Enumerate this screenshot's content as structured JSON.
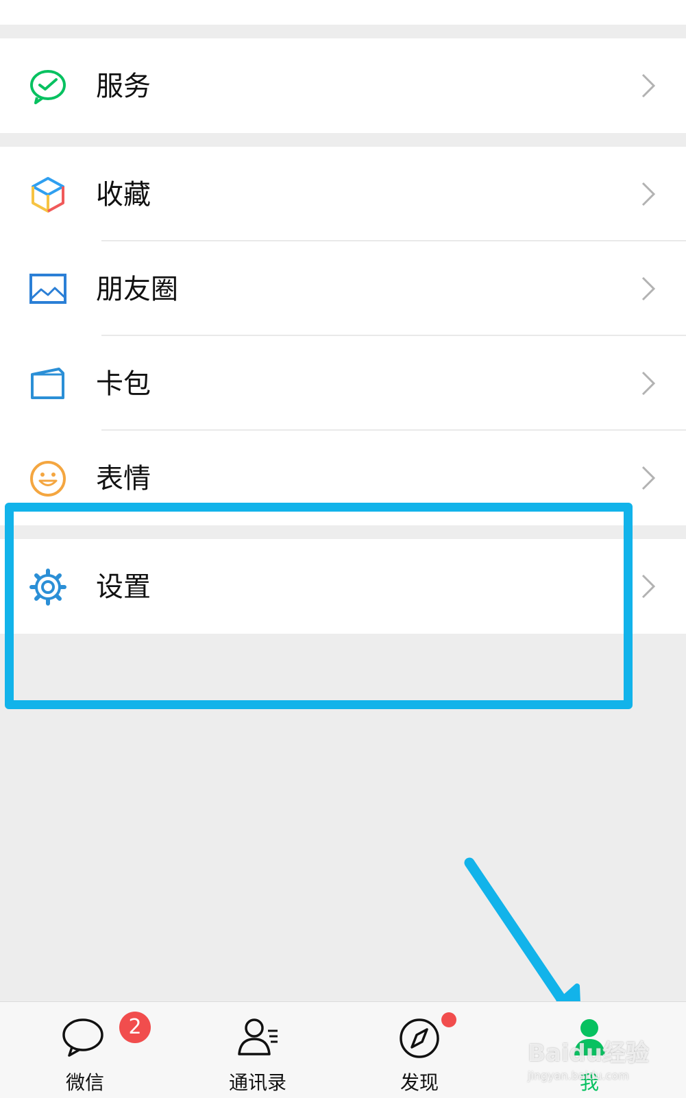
{
  "menu": {
    "services": {
      "label": "服务",
      "icon": "wechat-pay-icon"
    },
    "favorites": {
      "label": "收藏",
      "icon": "cube-icon"
    },
    "moments": {
      "label": "朋友圈",
      "icon": "picture-icon"
    },
    "cards": {
      "label": "卡包",
      "icon": "wallet-icon"
    },
    "stickers": {
      "label": "表情",
      "icon": "smiley-icon"
    },
    "settings": {
      "label": "设置",
      "icon": "gear-icon"
    }
  },
  "tabbar": {
    "chats": {
      "label": "微信",
      "badge": "2",
      "icon": "chat-bubble-icon"
    },
    "contacts": {
      "label": "通讯录",
      "icon": "contacts-icon"
    },
    "discover": {
      "label": "发现",
      "icon": "compass-icon"
    },
    "me": {
      "label": "我",
      "icon": "person-icon",
      "active": true
    }
  },
  "watermark": {
    "brand": "Baidu经验",
    "url": "jingyan.baidu.com"
  },
  "colors": {
    "accent_green": "#07c160",
    "highlight_blue": "#12b3ea",
    "badge_red": "#f14d4d"
  }
}
